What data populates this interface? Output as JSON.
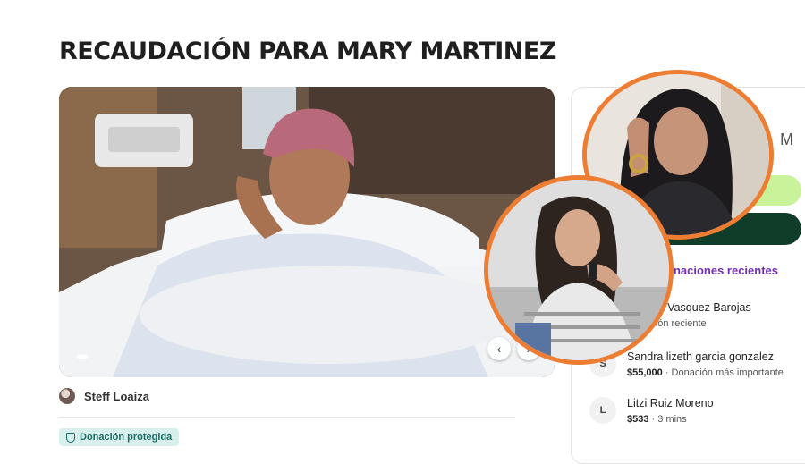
{
  "page": {
    "title": "RECAUDACIÓN PARA MARY MARTINEZ"
  },
  "photo": {
    "alt_icon": "hospital-patient-photo"
  },
  "organizer": {
    "name": "Steff Loaiza"
  },
  "badge": {
    "label": "Donación protegida",
    "icon": "shield-icon"
  },
  "card": {
    "partial_letter": "M",
    "recent_header": "onaciones recientes",
    "donations": [
      {
        "initial": "",
        "name": "a Maria Vasquez Barojas",
        "amount": "",
        "note": "Donación reciente"
      },
      {
        "initial": "S",
        "name": "Sandra lizeth garcia gonzalez",
        "amount": "$55,000",
        "note": "Donación más importante"
      },
      {
        "initial": "L",
        "name": "Litzi Ruiz Moreno",
        "amount": "$533",
        "note": "3 mins"
      }
    ]
  },
  "colors": {
    "accent_orange": "#ee7d34",
    "cta_light": "#c9f39a",
    "cta_dark": "#0f3d2a",
    "recent_purple": "#6f2fb3",
    "badge_bg": "#d7f0ee"
  }
}
